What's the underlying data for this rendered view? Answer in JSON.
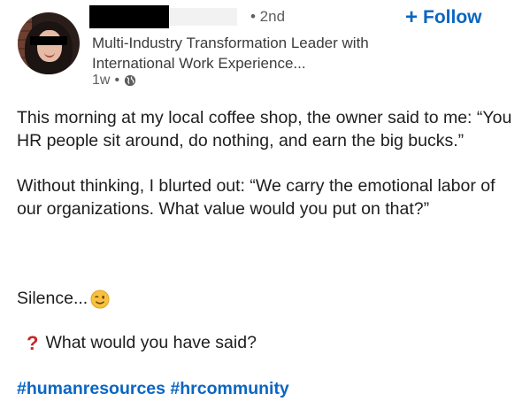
{
  "author": {
    "degree": "• 2nd",
    "headline": "Multi-Industry Transformation Leader with International Work Experience...",
    "time": "1w",
    "separator": "•",
    "visibility_icon": "globe-icon"
  },
  "follow": {
    "label": "Follow",
    "icon": "plus-icon"
  },
  "post": {
    "paragraph1": "This morning at my local coffee shop, the owner said to me: “You HR people sit around, do nothing, and earn the big bucks.”",
    "paragraph2": "Without thinking, I blurted out: “We carry the emotional labor of our organizations. What value would you put on that?”",
    "silence": "Silence...",
    "silence_emoji": "wink-icon",
    "question_icon": "question-mark-icon",
    "question": "What would you have said?",
    "hashtags": [
      "#humanresources",
      "#hrcommunity"
    ]
  },
  "colors": {
    "link": "#0a66c2",
    "question": "#c62828"
  }
}
